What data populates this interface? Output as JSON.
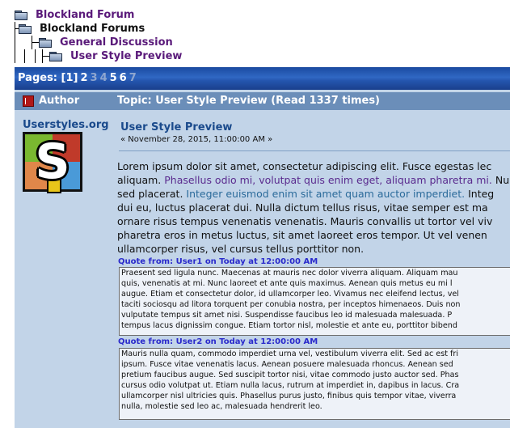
{
  "breadcrumbs": [
    {
      "label": "Blockland Forum",
      "style": "purple"
    },
    {
      "label": "Blockland Forums",
      "style": "black"
    },
    {
      "label": "General Discussion",
      "style": "purple"
    },
    {
      "label": "User Style Preview",
      "style": "purple"
    }
  ],
  "pages": {
    "label": "Pages:",
    "items": [
      {
        "text": "[1]",
        "state": "current"
      },
      {
        "text": "2",
        "state": "link"
      },
      {
        "text": "3",
        "state": "dim"
      },
      {
        "text": "4",
        "state": "dim"
      },
      {
        "text": "5",
        "state": "link"
      },
      {
        "text": "6",
        "state": "link"
      },
      {
        "text": "7",
        "state": "dim"
      }
    ]
  },
  "header": {
    "author_label": "Author",
    "topic_label": "Topic: User Style Preview  (Read 1337 times)"
  },
  "post": {
    "poster_name": "Userstyles.org",
    "avatar_letter": "S",
    "title": "User Style Preview",
    "date": "« November 28, 2015, 11:00:00 AM »",
    "body_lines": [
      [
        {
          "t": "Lorem ipsum dolor sit amet, consectetur adipiscing elit. Fusce egestas lec",
          "c": ""
        }
      ],
      [
        {
          "t": "aliquam. ",
          "c": ""
        },
        {
          "t": "Phasellus odio mi, volutpat quis enim eget, aliquam pharetra mi.",
          "c": "purple"
        },
        {
          "t": " Nu",
          "c": ""
        }
      ],
      [
        {
          "t": "sed placerat. ",
          "c": ""
        },
        {
          "t": "Integer euismod enim sit amet quam auctor imperdiet.",
          "c": "teal"
        },
        {
          "t": " Integ",
          "c": ""
        }
      ],
      [
        {
          "t": "dui eu, luctus placerat dui. Nulla dictum tellus risus, vitae semper est ma",
          "c": ""
        }
      ],
      [
        {
          "t": "ornare risus tempus venenatis venenatis. Mauris convallis ut tortor vel viv",
          "c": ""
        }
      ],
      [
        {
          "t": "pharetra eros in metus luctus, sit amet laoreet eros tempor. Ut vel venen",
          "c": ""
        }
      ],
      [
        {
          "t": "ullamcorper risus, vel cursus tellus porttitor non.",
          "c": ""
        }
      ]
    ],
    "quotes": [
      {
        "header": "Quote from: User1 on Today at 12:00:00 AM",
        "lines": [
          "Praesent sed ligula nunc. Maecenas at mauris nec dolor viverra aliquam. Aliquam mau",
          "quis, venenatis at mi. Nunc laoreet et ante quis maximus. Aenean quis metus eu mi l",
          "augue. Etiam et consectetur dolor, id ullamcorper leo. Vivamus nec eleifend lectus, vel",
          "taciti sociosqu ad litora torquent per conubia nostra, per inceptos himenaeos. Duis non",
          "vulputate tempus sit amet nisi. Suspendisse faucibus leo id malesuada malesuada. P",
          "tempus lacus dignissim congue. Etiam tortor nisl, molestie et ante eu, porttitor bibend"
        ]
      },
      {
        "header": "Quote from: User2 on Today at 12:00:00 AM",
        "lines": [
          "Mauris nulla quam, commodo imperdiet urna vel, vestibulum viverra elit. Sed ac est fri",
          "ipsum. Fusce vitae venenatis lacus. Aenean posuere malesuada rhoncus. Aenean sed",
          "pretium faucibus augue. Sed suscipit tortor nisi, vitae commodo justo auctor sed. Phas",
          "cursus odio volutpat ut. Etiam nulla lacus, rutrum at imperdiet in, dapibus in lacus. Cra",
          "ullamcorper nisl ultricies quis. Phasellus purus justo, finibus quis tempor vitae, viverra",
          "nulla, molestie sed leo ac, malesuada hendrerit leo."
        ]
      }
    ]
  },
  "colors": {
    "purple_link": "#5a1a7a",
    "blue_title": "#1a4a8c",
    "panel_bg": "#c2d4e8",
    "header_bar": "#6b8eb9"
  }
}
